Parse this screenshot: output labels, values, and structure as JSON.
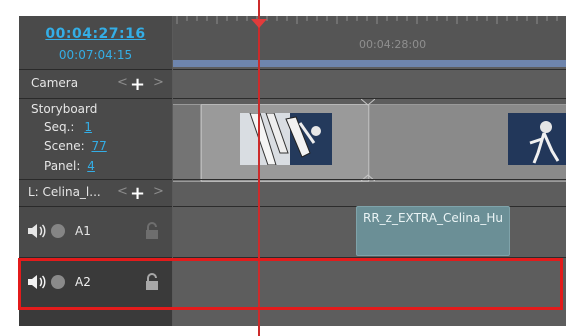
{
  "timecode": {
    "current": "00:04:27:16",
    "total": "00:07:04:15"
  },
  "ruler": {
    "timestamp": "00:04:28:00"
  },
  "camera": {
    "label": "Camera",
    "prev": "<",
    "add": "+",
    "next": ">"
  },
  "storyboard": {
    "title": "Storyboard",
    "seq_label": "Seq.:",
    "seq_value": "1",
    "scene_label": "Scene:",
    "scene_value": "77",
    "panel_label": "Panel:",
    "panel_value": "4"
  },
  "layer": {
    "label": "L: Celina_l...",
    "prev": "<",
    "add": "+",
    "next": ">"
  },
  "tracks": [
    {
      "name": "A1",
      "selected": false
    },
    {
      "name": "A2",
      "selected": true
    }
  ],
  "audio_clip": {
    "name": "RR_z_EXTRA_Celina_Hu"
  },
  "colors": {
    "accent": "#34aee6",
    "playhead": "#cc2b2b",
    "highlight": "#e31b1b",
    "audio_clip": "#6b8f96"
  }
}
